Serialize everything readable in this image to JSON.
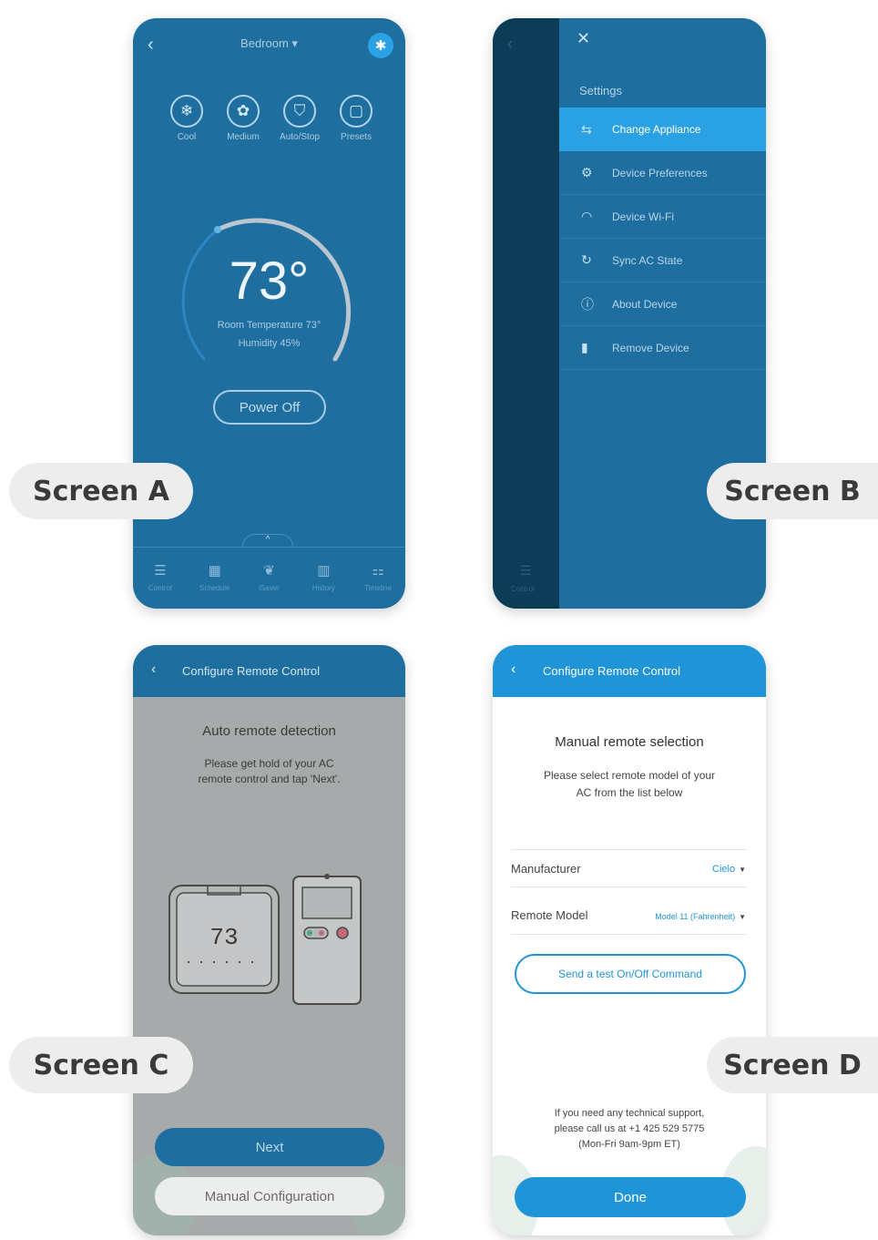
{
  "labels": {
    "a": "Screen A",
    "b": "Screen B",
    "c": "Screen C",
    "d": "Screen D"
  },
  "screen_a": {
    "room": "Bedroom ▾",
    "modes": [
      {
        "label": "Cool",
        "icon": "snowflake-icon"
      },
      {
        "label": "Medium",
        "icon": "fan-icon"
      },
      {
        "label": "Auto/Stop",
        "icon": "shield-icon"
      },
      {
        "label": "Presets",
        "icon": "presets-icon"
      }
    ],
    "temperature": "73°",
    "room_temperature": "Room Temperature 73°",
    "humidity": "Humidity 45%",
    "power_button": "Power Off",
    "nav": [
      {
        "label": "Control",
        "icon": "sliders-icon"
      },
      {
        "label": "Schedule",
        "icon": "calendar-icon"
      },
      {
        "label": "iSaver",
        "icon": "leaf-icon"
      },
      {
        "label": "History",
        "icon": "chart-icon"
      },
      {
        "label": "Timeline",
        "icon": "timeline-icon"
      }
    ]
  },
  "screen_b": {
    "title": "Settings",
    "left_nav_label": "Control",
    "menu": [
      {
        "label": "Change Appliance",
        "icon": "swap-icon",
        "active": true
      },
      {
        "label": "Device Preferences",
        "icon": "gears-icon",
        "active": false
      },
      {
        "label": "Device Wi-Fi",
        "icon": "wifi-icon",
        "active": false
      },
      {
        "label": "Sync AC State",
        "icon": "sync-icon",
        "active": false
      },
      {
        "label": "About Device",
        "icon": "info-icon",
        "active": false
      },
      {
        "label": "Remove Device",
        "icon": "trash-icon",
        "active": false
      }
    ]
  },
  "screen_c": {
    "title": "Configure Remote Control",
    "heading": "Auto remote detection",
    "body_line1": "Please get hold of your AC",
    "body_line2": "remote control and tap 'Next'.",
    "thermostat_display": "73",
    "next_button": "Next",
    "manual_button": "Manual Configuration"
  },
  "screen_d": {
    "title": "Configure Remote Control",
    "heading": "Manual remote selection",
    "body_line1": "Please select remote model of your",
    "body_line2": "AC from the list below",
    "manufacturer_label": "Manufacturer",
    "manufacturer_value": "Cielo",
    "model_label": "Remote Model",
    "model_value": "Model 11 (Fahrenheit)",
    "test_button": "Send a test On/Off Command",
    "support_line1": "If you need any technical support,",
    "support_line2": "please call us at +1 425 529 5775",
    "support_line3": "(Mon-Fri 9am-9pm ET)",
    "done_button": "Done"
  },
  "colors": {
    "primary_dark": "#1e6fa0",
    "primary_bright": "#1f94d6",
    "active_menu": "#2aa1e2"
  }
}
